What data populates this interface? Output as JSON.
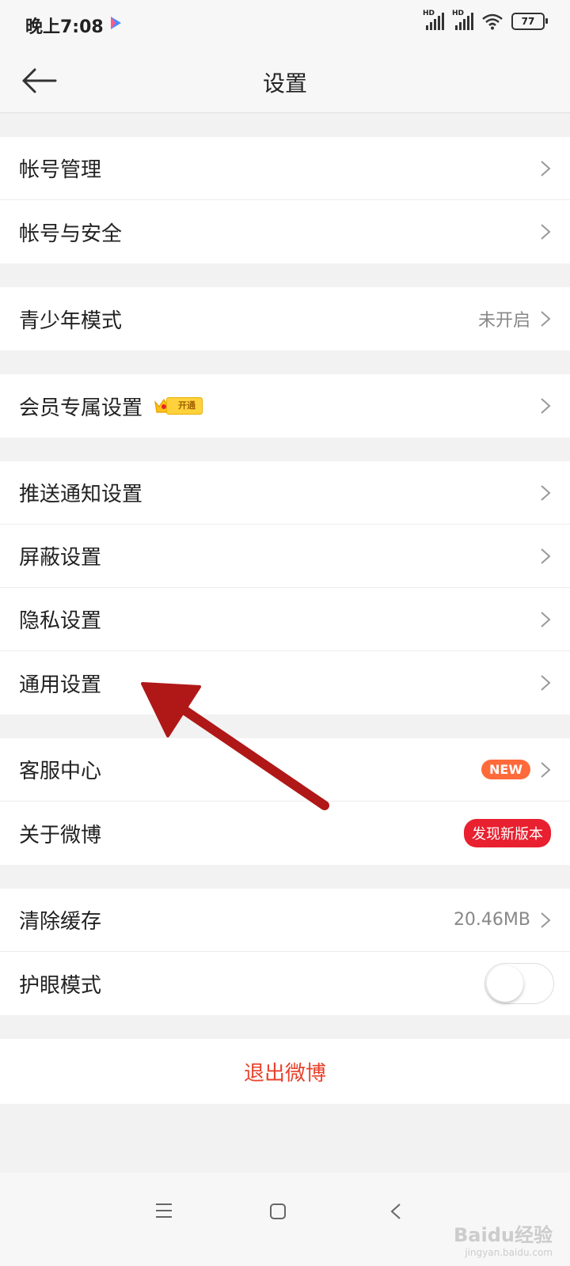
{
  "status": {
    "time": "晚上7:08",
    "hd1": "HD",
    "hd2": "HD",
    "battery": "77"
  },
  "nav": {
    "title": "设置"
  },
  "groups": {
    "account": {
      "manage": "帐号管理",
      "security": "帐号与安全"
    },
    "youth": {
      "label": "青少年模式",
      "value": "未开启"
    },
    "vip": {
      "label": "会员专属设置",
      "badge": "开通"
    },
    "notify": {
      "push": "推送通知设置",
      "block": "屏蔽设置",
      "privacy": "隐私设置",
      "general": "通用设置"
    },
    "service": {
      "center": "客服中心",
      "center_badge": "NEW",
      "about": "关于微博",
      "about_badge": "发现新版本"
    },
    "misc": {
      "cache": "清除缓存",
      "cache_value": "20.46MB",
      "eye": "护眼模式",
      "eye_on": false
    }
  },
  "logout": "退出微博",
  "watermark": {
    "brand": "Baidu经验",
    "url": "jingyan.baidu.com"
  },
  "colors": {
    "accent": "#e8412b",
    "badge_new": "#ff6a3a",
    "badge_update": "#e8202f",
    "annotation_arrow": "#b01818"
  },
  "icons": [
    "back-arrow-icon",
    "chevron-right-icon",
    "crown-icon",
    "menu-icon",
    "home-square-icon",
    "back-chevron-icon",
    "wifi-icon",
    "signal-icon",
    "battery-icon",
    "play-icon"
  ]
}
